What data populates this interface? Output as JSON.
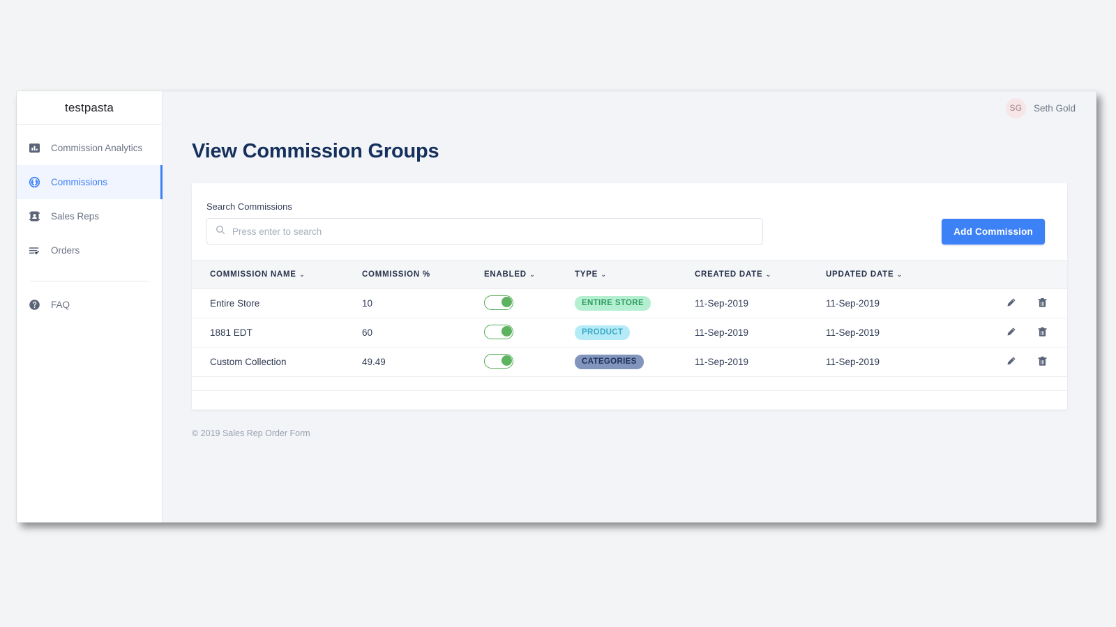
{
  "brand": {
    "name": "testpasta"
  },
  "sidebar": {
    "items": [
      {
        "label": "Commission Analytics",
        "icon": "bar-chart-icon",
        "active": false
      },
      {
        "label": "Commissions",
        "icon": "dollar-circle-icon",
        "active": true
      },
      {
        "label": "Sales Reps",
        "icon": "id-card-icon",
        "active": false
      },
      {
        "label": "Orders",
        "icon": "list-check-icon",
        "active": false
      }
    ],
    "faq": {
      "label": "FAQ",
      "icon": "question-circle-icon"
    }
  },
  "topbar": {
    "avatar_initials": "SG",
    "user_name": "Seth Gold"
  },
  "page": {
    "title": "View Commission Groups",
    "footer": "© 2019 Sales Rep Order Form"
  },
  "search": {
    "label": "Search Commissions",
    "placeholder": "Press enter to search",
    "value": "",
    "icon": "search-icon"
  },
  "actions": {
    "add_label": "Add Commission"
  },
  "table": {
    "columns": [
      {
        "label": "COMMISSION NAME",
        "sortable": true
      },
      {
        "label": "COMMISSION %",
        "sortable": false
      },
      {
        "label": "ENABLED",
        "sortable": true
      },
      {
        "label": "TYPE",
        "sortable": true
      },
      {
        "label": "CREATED DATE",
        "sortable": true
      },
      {
        "label": "UPDATED DATE",
        "sortable": true
      },
      {
        "label": "",
        "sortable": false
      }
    ],
    "caret": "⌄",
    "rows": [
      {
        "name": "Entire Store",
        "percent": "10",
        "enabled": true,
        "type": "ENTIRE STORE",
        "type_class": "entire",
        "created": "11-Sep-2019",
        "updated": "11-Sep-2019"
      },
      {
        "name": "1881 EDT",
        "percent": "60",
        "enabled": true,
        "type": "PRODUCT",
        "type_class": "product",
        "created": "11-Sep-2019",
        "updated": "11-Sep-2019"
      },
      {
        "name": "Custom Collection",
        "percent": "49.49",
        "enabled": true,
        "type": "CATEGORIES",
        "type_class": "category",
        "created": "11-Sep-2019",
        "updated": "11-Sep-2019"
      }
    ],
    "row_actions": [
      {
        "name": "edit-icon",
        "label": "Edit"
      },
      {
        "name": "delete-icon",
        "label": "Delete"
      }
    ]
  },
  "colors": {
    "accent_blue": "#3d81f6",
    "toggle_green": "#5db35f",
    "badge_entire_bg": "#b5efd1",
    "badge_product_bg": "#b5ebf6",
    "badge_category_bg": "#8195bd",
    "title_navy": "#15305c",
    "page_bg": "#f2f4f7"
  }
}
